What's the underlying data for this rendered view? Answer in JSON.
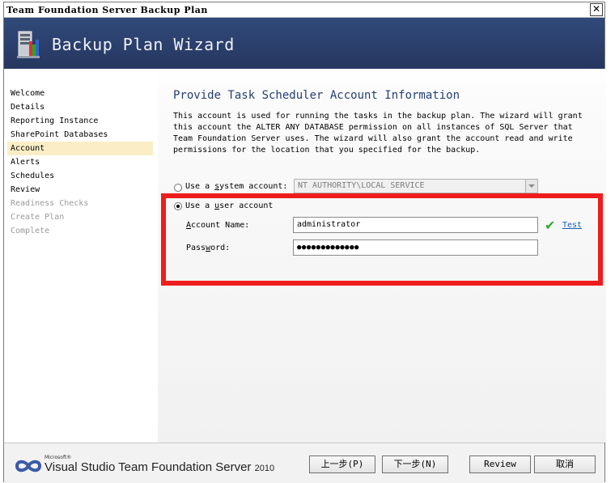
{
  "window": {
    "title": "Team Foundation Server Backup Plan",
    "close_glyph": "✕"
  },
  "banner": {
    "title": "Backup Plan Wizard",
    "icon": "server-wizard-icon"
  },
  "sidebar": {
    "items": [
      {
        "label": "Welcome",
        "state": "normal"
      },
      {
        "label": "Details",
        "state": "normal"
      },
      {
        "label": "Reporting Instance",
        "state": "normal"
      },
      {
        "label": "SharePoint Databases",
        "state": "normal"
      },
      {
        "label": "Account",
        "state": "active"
      },
      {
        "label": "Alerts",
        "state": "normal"
      },
      {
        "label": "Schedules",
        "state": "normal"
      },
      {
        "label": "Review",
        "state": "normal"
      },
      {
        "label": "Readiness Checks",
        "state": "disabled"
      },
      {
        "label": "Create Plan",
        "state": "disabled"
      },
      {
        "label": "Complete",
        "state": "disabled"
      }
    ]
  },
  "main": {
    "heading": "Provide Task Scheduler Account Information",
    "description": "This account is used for running the tasks in the backup plan. The wizard will grant this account the ALTER ANY DATABASE permission on all instances of SQL Server that Team Foundation Server uses. The wizard will also grant the account read and write permissions for the location that you specified for the backup.",
    "system_account": {
      "label_pre": "Use a ",
      "label_key": "s",
      "label_post": "ystem account:",
      "value": "NT AUTHORITY\\LOCAL SERVICE",
      "selected": false
    },
    "user_account": {
      "label_pre": "Use a ",
      "label_key": "u",
      "label_post": "ser account",
      "selected": true
    },
    "account_name": {
      "label_key": "A",
      "label_post": "ccount Name:",
      "value": "administrator"
    },
    "password": {
      "label_pre": "Pass",
      "label_key": "w",
      "label_post": "ord:",
      "value": "●●●●●●●●●●●●●"
    },
    "test_link": "Test",
    "check_glyph": "✔"
  },
  "footer": {
    "logo": {
      "microsoft": "Microsoft®",
      "product": "Visual Studio Team Foundation Server",
      "version": "2010"
    },
    "buttons": {
      "previous": "上一步(P)",
      "next": "下一步(N)",
      "review": "Review",
      "cancel": "取消"
    }
  },
  "colors": {
    "banner": "#2b3f6c",
    "highlight": "#ee1c1c",
    "active_item": "#fbeec6",
    "heading": "#253e74",
    "link": "#1060c0"
  }
}
